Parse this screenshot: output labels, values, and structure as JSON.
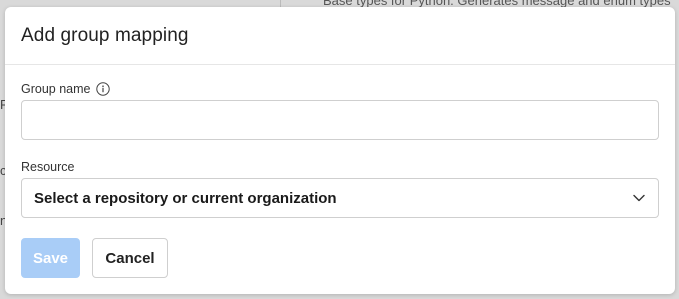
{
  "background": {
    "text": "Base types for Python. Generates message and enum types",
    "edge_glyphs": [
      "F",
      "c",
      "n"
    ]
  },
  "modal": {
    "title": "Add group mapping",
    "group_name": {
      "label": "Group name",
      "value": "",
      "placeholder": ""
    },
    "resource": {
      "label": "Resource",
      "selected": "Select a repository or current organization"
    },
    "buttons": {
      "save": "Save",
      "cancel": "Cancel"
    }
  },
  "colors": {
    "save_disabled_bg": "#a9cdf7",
    "border": "#cfcfcf",
    "title_text": "#222222"
  },
  "icons": {
    "info": "info-circle-icon",
    "chevron": "chevron-down-icon"
  }
}
